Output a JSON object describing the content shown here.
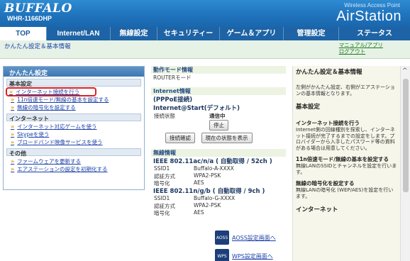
{
  "header": {
    "brand": "BUFFALO",
    "model": "WHR-1166DHP",
    "wap_label": "Wireless Access Point",
    "product": "AirStation"
  },
  "nav": {
    "tabs": [
      "TOP",
      "Internet/LAN",
      "無線設定",
      "セキュリティー",
      "ゲーム＆アプリ",
      "管理設定",
      "ステータス"
    ]
  },
  "subbar": {
    "breadcrumb": "かんたん設定＆基本情報",
    "manual": "マニュアル/アプリ",
    "logout": "ログアウト"
  },
  "left": {
    "title": "かんたん設定",
    "sections": [
      {
        "title": "基本設定",
        "items": [
          "インターネット接続を行う",
          "11n倍速モード/無線の基本を設定する",
          "無線の暗号化を設定する"
        ]
      },
      {
        "title": "インターネット",
        "items": [
          "インターネット対応ゲームを使う",
          "Skypeを使う",
          "ブロードバンド映像サービスを使う"
        ]
      },
      {
        "title": "その他",
        "items": [
          "ファームウェアを更新する",
          "エアステーションの設定を初期化する"
        ]
      }
    ]
  },
  "mid": {
    "mode_head": "動作モード情報",
    "mode_value": "ROUTERモード",
    "internet_head": "Internet情報",
    "internet_sub": "(PPPoE接続)",
    "internet_start": "Internet@Start(デフォルト)",
    "conn_label": "接続状態",
    "conn_value": "通信中",
    "stop_btn": "停止",
    "confirm_btn": "接続確認",
    "show_btn": "現在の状態を表示",
    "wireless_head": "無線情報",
    "band1_title": "IEEE 802.11ac/n/a ( 自動取得 / 52ch )",
    "band1_rows": [
      [
        "SSID1",
        "Buffalo-A-XXXX"
      ],
      [
        "認証方式",
        "WPA2-PSK"
      ],
      [
        "暗号化",
        "AES"
      ]
    ],
    "band2_title": "IEEE 802.11n/g/b ( 自動取得 / 9ch )",
    "band2_rows": [
      [
        "SSID1",
        "Buffalo-G-XXXX"
      ],
      [
        "認証方式",
        "WPA2-PSK"
      ],
      [
        "暗号化",
        "AES"
      ]
    ],
    "aoss_link": "AOSS設定画面へ",
    "wps_link": "WPS設定画面へ"
  },
  "right": {
    "head": "かんたん設定＆基本情報",
    "intro": "左側がかんたん設定、右側がエアステーションの基本情報となります。",
    "section1": "基本設定",
    "sub1": "インターネット接続を行う",
    "sub1_text": "Internet側の回線種別を探索し、インターネット接続が完了するまでの設定をします。プロバイダーから入手したパスワード等の資料がある場合は用意してください。",
    "sub2": "11n倍速モード/無線の基本を設定する",
    "sub2_text": "無線LANのSSIDとチャンネルを設定を行います。",
    "sub3": "無線の暗号化を設定する",
    "sub3_text": "無線LANの暗号化 (WEP/AES)を設定を行います。",
    "section2": "インターネット"
  },
  "colors": {
    "header_blue": "#1f72bb",
    "link_blue": "#1a3fa8",
    "highlight_red": "#e02020"
  }
}
